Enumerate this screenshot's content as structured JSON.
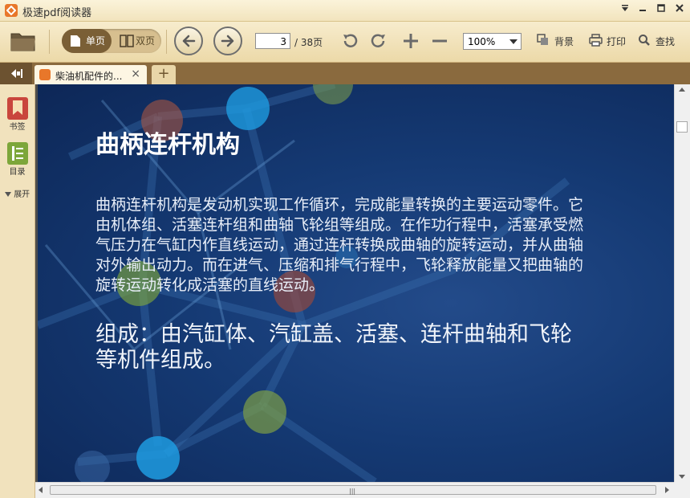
{
  "window": {
    "title": "极速pdf阅读器",
    "controls": [
      "menu-icon",
      "minimize-icon",
      "maximize-icon",
      "close-icon"
    ]
  },
  "toolbar": {
    "single_page_label": "单页",
    "double_page_label": "双页",
    "current_page": "3",
    "total_pages": "/ 38页",
    "zoom": "100%",
    "background_label": "背景",
    "print_label": "打印",
    "find_label": "查找"
  },
  "tabs": [
    {
      "label": "柴油机配件的...",
      "close": "×"
    }
  ],
  "new_tab": "+",
  "sidebar": {
    "bookmarks_label": "书签",
    "toc_label": "目录",
    "expand_label": "展开"
  },
  "slide": {
    "title": "曲柄连杆机构",
    "body": "曲柄连杆机构是发动机实现工作循环，完成能量转换的主要运动零件。它由机体组、活塞连杆组和曲轴飞轮组等组成。在作功行程中，活塞承受燃气压力在气缸内作直线运动，通过连杆转换成曲轴的旋转运动，并从曲轴对外输出动力。而在进气、压缩和排气行程中，飞轮释放能量又把曲轴的旋转运动转化成活塞的直线运动。",
    "composition": "组成：由汽缸体、汽缸盖、活塞、连杆曲轴和飞轮等机件组成。"
  },
  "colors": {
    "brand": "#e8772a",
    "toolbar_bg": "#f2e4bd",
    "tabstrip_bg": "#8a6a3e",
    "slide_bg": "#153a74"
  },
  "scroll": {
    "vertical_grip": "",
    "horizontal_grip": "|||"
  }
}
